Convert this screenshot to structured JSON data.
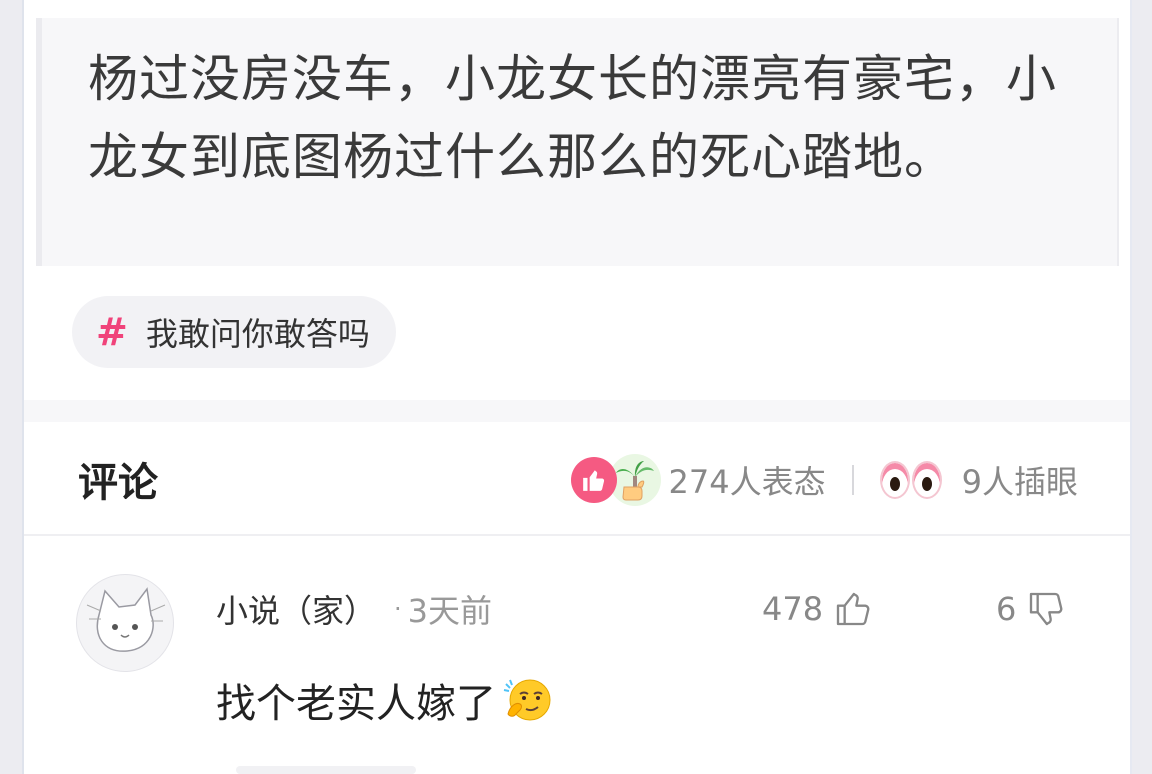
{
  "question": {
    "text": "杨过没房没车，小龙女长的漂亮有豪宅，小龙女到底图杨过什么那么的死心踏地。"
  },
  "topic": {
    "symbol": "#",
    "label": "我敢问你敢答吗"
  },
  "comments_section": {
    "title": "评论",
    "reactions_count": "274人表态",
    "watchers_count": "9人插眼"
  },
  "comment": {
    "author": "小说（家）",
    "separator": "·",
    "time": "3天前",
    "likes": "478",
    "dislikes": "6",
    "text": "找个老实人嫁了"
  },
  "icons": {
    "like_bubble": "thumbs-up-icon",
    "palm_bubble": "palm-tree-thumb-icon",
    "eyes": "eyes-icon",
    "like": "thumbs-up-outline-icon",
    "dislike": "thumbs-down-outline-icon",
    "emoji": "smirk-emoji-icon"
  },
  "colors": {
    "accent_pink": "#f0437a",
    "like_bubble": "#f55a82",
    "muted_text": "#888888"
  }
}
